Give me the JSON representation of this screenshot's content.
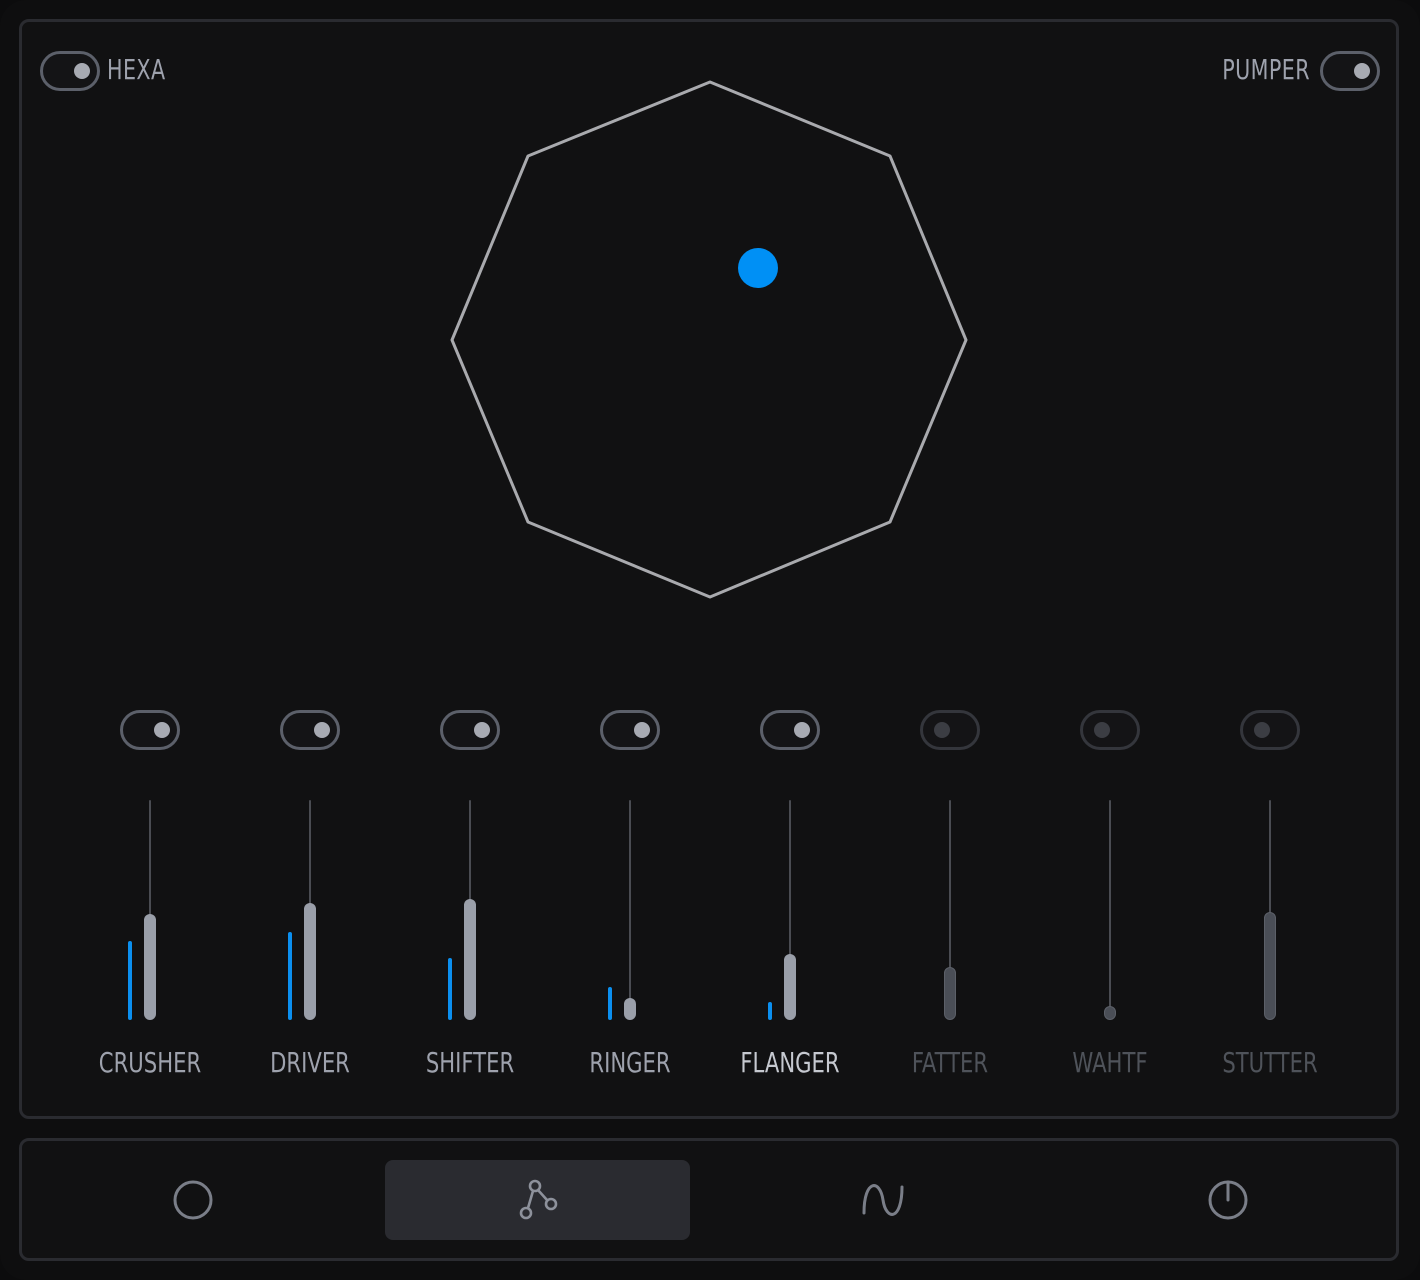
{
  "header": {
    "hexa": {
      "label": "HEXA",
      "on": true
    },
    "pumper": {
      "label": "PUMPER",
      "on": true
    }
  },
  "xy_pad": {
    "shape": "octagon",
    "handle_color": "#0090f5"
  },
  "channels": [
    {
      "name": "CRUSHER",
      "enabled": true,
      "level": 0.48,
      "meter": 0.36
    },
    {
      "name": "DRIVER",
      "enabled": true,
      "level": 0.53,
      "meter": 0.4
    },
    {
      "name": "SHIFTER",
      "enabled": true,
      "level": 0.55,
      "meter": 0.28
    },
    {
      "name": "RINGER",
      "enabled": true,
      "level": 0.1,
      "meter": 0.15
    },
    {
      "name": "FLANGER",
      "enabled": true,
      "level": 0.3,
      "meter": 0.08
    },
    {
      "name": "FATTER",
      "enabled": false,
      "level": 0.24,
      "meter": 0
    },
    {
      "name": "WAHTF",
      "enabled": false,
      "level": 0.04,
      "meter": 0
    },
    {
      "name": "STUTTER",
      "enabled": false,
      "level": 0.49,
      "meter": 0
    }
  ],
  "nav": {
    "items": [
      {
        "icon": "circle-icon",
        "active": false
      },
      {
        "icon": "nodes-icon",
        "active": true
      },
      {
        "icon": "sine-wave-icon",
        "active": false
      },
      {
        "icon": "power-icon",
        "active": false
      }
    ]
  },
  "colors": {
    "accent": "#0090f5",
    "panel_border": "#2a2b30",
    "text": "#9ea2ad"
  }
}
